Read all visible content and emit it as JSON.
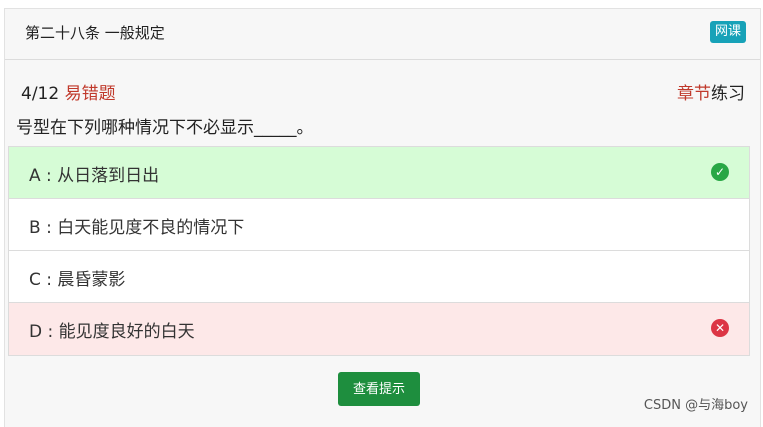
{
  "header": {
    "chapter_title": "第二十八条 一般规定",
    "badge": "网课"
  },
  "meta": {
    "progress": "4/12",
    "tag": "易错题",
    "category_red": "章节",
    "category_rest": "练习"
  },
  "question": {
    "text": "号型在下列哪种情况下不必显示_____。"
  },
  "options": [
    {
      "label": "A : 从日落到日出",
      "state": "correct"
    },
    {
      "label": "B : 白天能见度不良的情况下",
      "state": "normal"
    },
    {
      "label": "C : 晨昏蒙影",
      "state": "normal"
    },
    {
      "label": "D : 能见度良好的白天",
      "state": "wrong"
    }
  ],
  "icons": {
    "correct": "check-circle-icon",
    "wrong": "x-circle-icon"
  },
  "colors": {
    "correct_bg": "#d6fcd6",
    "wrong_bg": "#fde8e8",
    "accent": "#1e8e3e"
  },
  "actions": {
    "hint_label": "查看提示"
  },
  "footer": {
    "credit": "CSDN @与海boy"
  }
}
